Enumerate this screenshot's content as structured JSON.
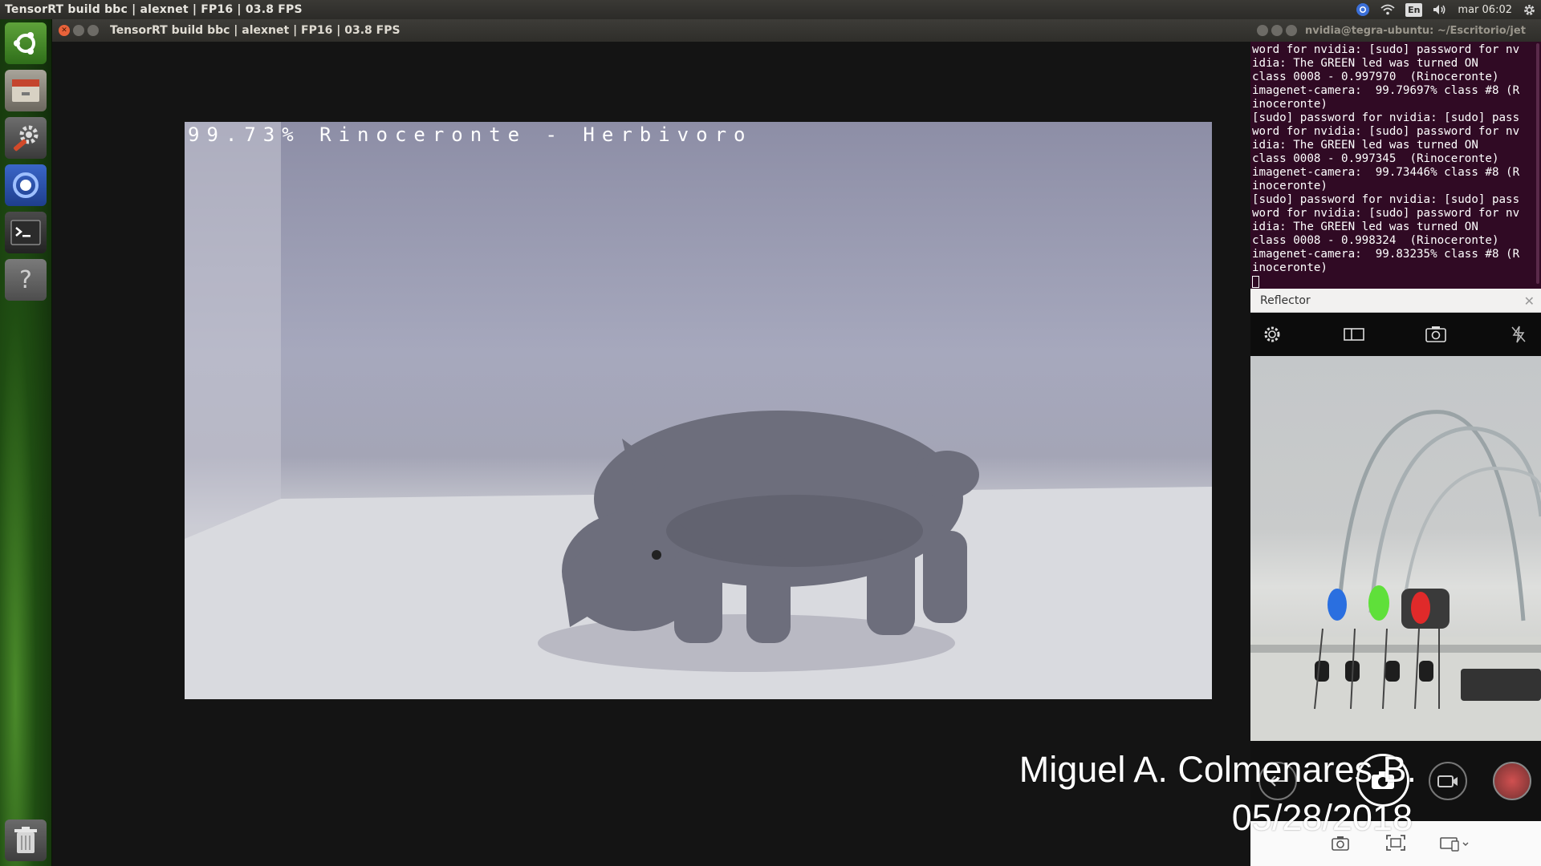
{
  "topbar": {
    "title": "TensorRT build bbc | alexnet | FP16 | 03.8 FPS",
    "lang": "En",
    "clock": "mar 06:02"
  },
  "launcher": {
    "items": [
      {
        "name": "ubuntu-dash-icon"
      },
      {
        "name": "files-icon"
      },
      {
        "name": "system-settings-icon"
      },
      {
        "name": "chromium-icon"
      },
      {
        "name": "terminal-icon"
      },
      {
        "name": "help-icon"
      },
      {
        "name": "trash-icon"
      }
    ]
  },
  "window": {
    "title": "TensorRT build bbc | alexnet | FP16 | 03.8 FPS",
    "overlay": "99.73% Rinoceronte - Herbivoro"
  },
  "terminal": {
    "title": "nvidia@tegra-ubuntu: ~/Escritorio/jet",
    "lines": [
      "word for nvidia: [sudo] password for nv",
      "idia: The GREEN led was turned ON",
      "class 0008 - 0.997970  (Rinoceronte)",
      "imagenet-camera:  99.79697% class #8 (R",
      "inoceronte)",
      "[sudo] password for nvidia: [sudo] pass",
      "word for nvidia: [sudo] password for nv",
      "idia: The GREEN led was turned ON",
      "class 0008 - 0.997345  (Rinoceronte)",
      "imagenet-camera:  99.73446% class #8 (R",
      "inoceronte)",
      "[sudo] password for nvidia: [sudo] pass",
      "word for nvidia: [sudo] password for nv",
      "idia: The GREEN led was turned ON",
      "class 0008 - 0.998324  (Rinoceronte)",
      "imagenet-camera:  99.83235% class #8 (R",
      "inoceronte)"
    ]
  },
  "reflector": {
    "title": "Reflector"
  },
  "watermark": {
    "author": "Miguel A. Colmenares B.",
    "date": "05/28/2018"
  },
  "colors": {
    "term_bg": "#300a24",
    "close_button": "#e8623a",
    "led_blue": "#2a6fe0",
    "led_green": "#5fe03a",
    "led_red": "#e02a2a"
  }
}
